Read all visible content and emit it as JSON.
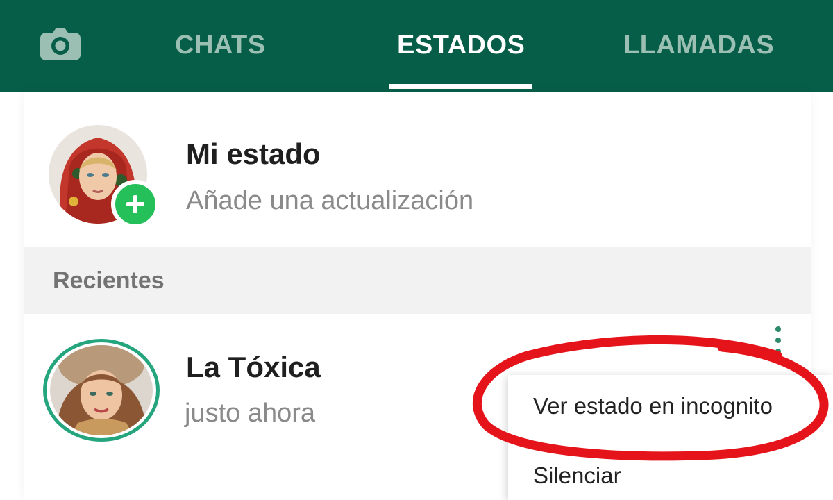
{
  "header": {
    "camera_icon": "camera-icon",
    "tabs": [
      {
        "label": "CHATS",
        "active": false
      },
      {
        "label": "ESTADOS",
        "active": true
      },
      {
        "label": "LLAMADAS",
        "active": false
      }
    ],
    "background_color": "#075e48",
    "active_tab_color": "#ffffff",
    "inactive_tab_color": "#9bc0b3"
  },
  "my_status": {
    "title": "Mi estado",
    "subtitle": "Añade una actualización",
    "add_icon": "plus-icon",
    "badge_color": "#25c05a"
  },
  "recent": {
    "section_label": "Recientes",
    "items": [
      {
        "name": "La Tóxica",
        "time": "justo ahora",
        "ring_color": "#25a57e"
      }
    ]
  },
  "menu": {
    "trigger_icon": "more-vert-icon",
    "items": [
      {
        "label": "Ver estado en incognito"
      },
      {
        "label": "Silenciar"
      }
    ]
  },
  "annotation": {
    "shape": "red-hand-drawn-ellipse",
    "color": "#e5141b"
  }
}
